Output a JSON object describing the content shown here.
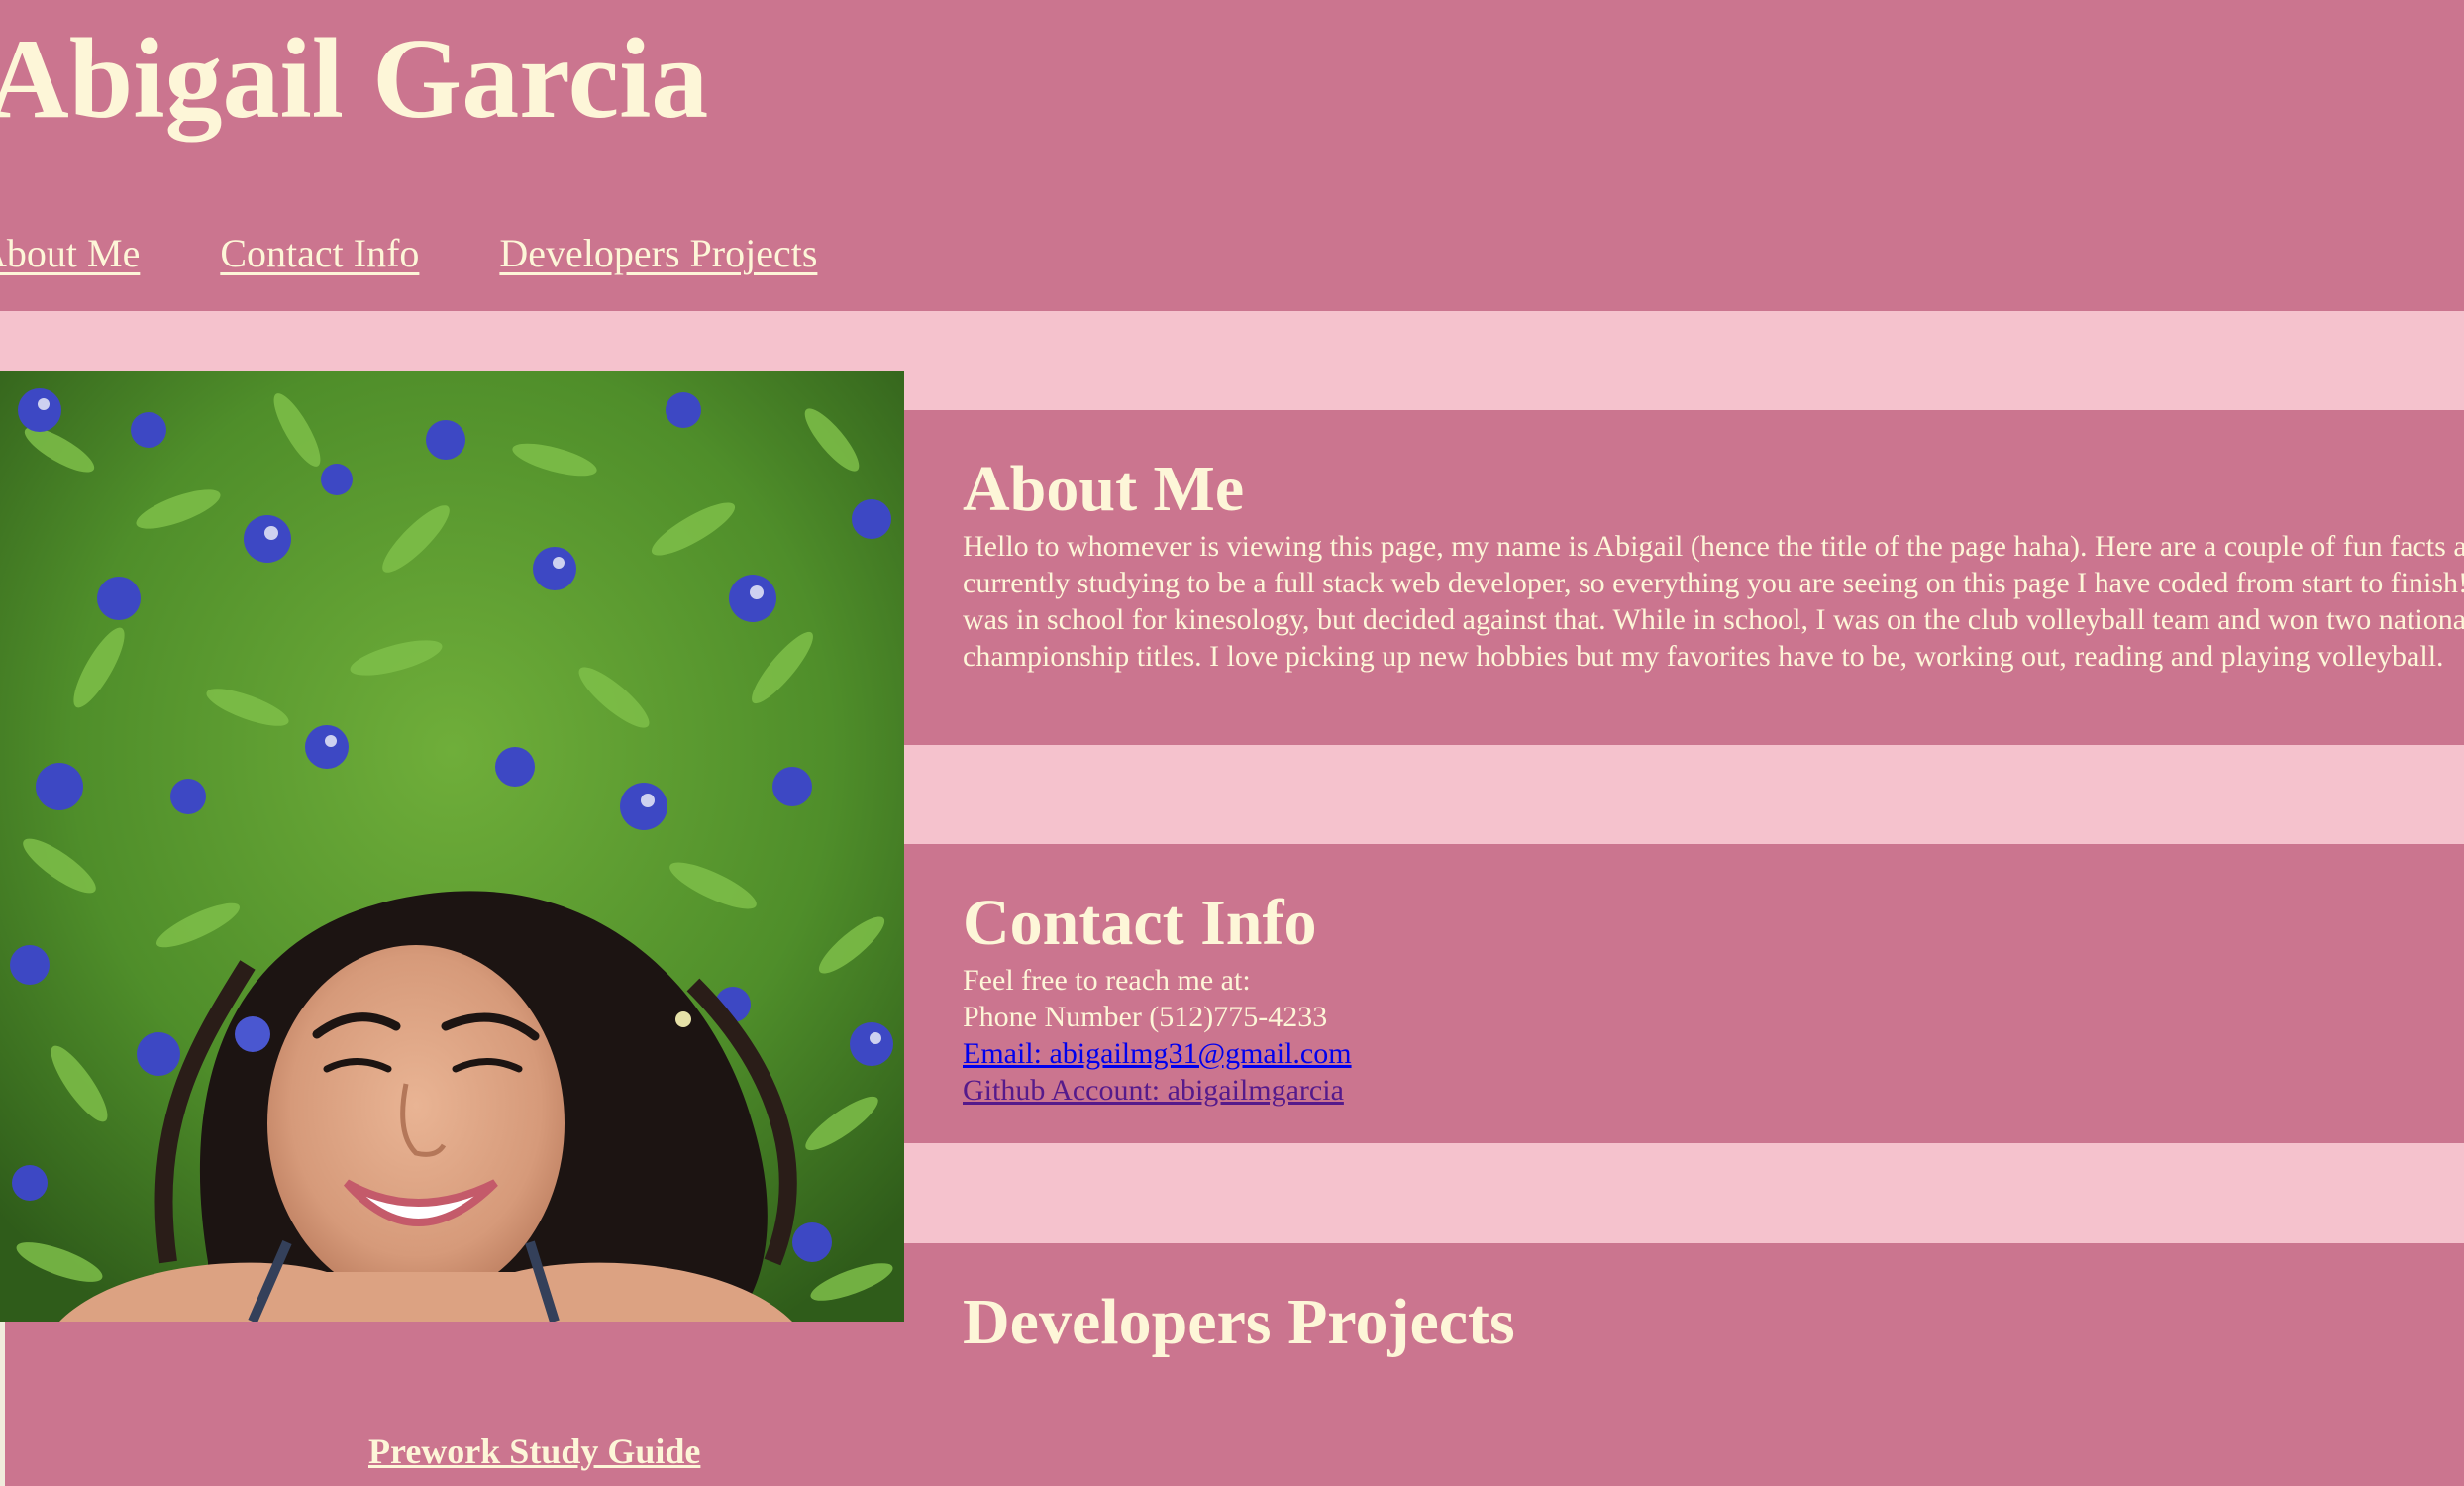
{
  "header": {
    "title": "Abigail Garcia",
    "nav": [
      "About Me",
      "Contact Info",
      "Developers Projects"
    ]
  },
  "about": {
    "heading": "About Me",
    "body": "Hello to whomever is viewing this page, my name is Abigail (hence the title of the page haha). Here are a couple of fun facts about me: I am currently studying to be a full stack web developer, so everything you are seeing on this page I have coded from start to finish! Before this I was in school for kinesology, but decided against that. While in school, I was on the club volleyball team and won two national championship titles. I love picking up new hobbies but my favorites have to be, working out, reading and playing volleyball."
  },
  "contact": {
    "heading": "Contact Info",
    "intro": "Feel free to reach me at:",
    "phone": "Phone Number (512)775-4233",
    "email": "Email: abigailmg31@gmail.com",
    "github": "Github Account: abigailmgarcia"
  },
  "projects": {
    "heading": "Developers Projects",
    "link": "Prework Study Guide"
  },
  "photo": {
    "icon": "profile-photo-bluebonnets"
  },
  "colors": {
    "panel": "#cb758f",
    "background": "#f5c2cd",
    "text": "#fdf6d8"
  }
}
